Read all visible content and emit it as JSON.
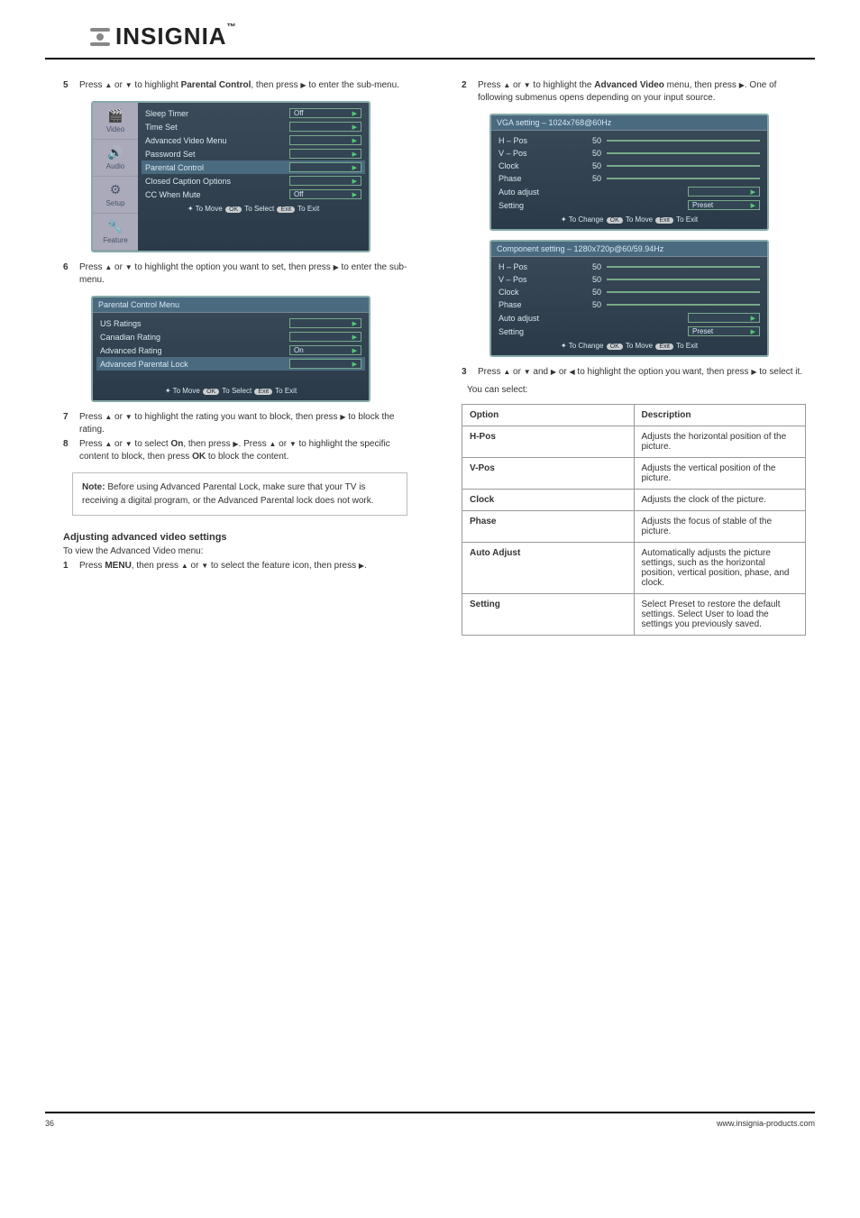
{
  "logo": {
    "text": "INSIGNIA",
    "trademark": "™"
  },
  "col1": {
    "step5": {
      "num": "5",
      "text_a": "Press ",
      "text_b": " or ",
      "text_c": " to highlight ",
      "text_bold": "Parental Control",
      "text_d": ", then press ",
      "text_e": " to enter the sub-menu."
    },
    "osd1": {
      "rows": [
        {
          "label": "Sleep Timer",
          "val": "Off",
          "hl": false
        },
        {
          "label": "Time Set",
          "val": "",
          "hl": false
        },
        {
          "label": "Advanced Video Menu",
          "val": "",
          "hl": false
        },
        {
          "label": "Password Set",
          "val": "",
          "hl": false
        },
        {
          "label": "Parental Control",
          "val": "",
          "hl": true
        },
        {
          "label": "Closed Caption Options",
          "val": "",
          "hl": false
        },
        {
          "label": "CC When Mute",
          "val": "Off",
          "hl": false
        }
      ],
      "icons": [
        {
          "glyph": "🎬",
          "label": "Video"
        },
        {
          "glyph": "🔊",
          "label": "Audio"
        },
        {
          "glyph": "⚙",
          "label": "Setup"
        },
        {
          "glyph": "🔧",
          "label": "Feature"
        }
      ],
      "controls": {
        "move": "To Move",
        "select": "To Select",
        "exit": "To Exit",
        "ok": "OK",
        "exitBtn": "Exit"
      }
    },
    "step6": {
      "num": "6",
      "text_a": "Press ",
      "text_b": " or ",
      "text_c": " to highlight the option you want to set, then press ",
      "text_d": " to enter the sub-menu."
    },
    "osd2": {
      "header": "Parental Control Menu",
      "rows": [
        {
          "label": "US Ratings",
          "val": "",
          "hl": false
        },
        {
          "label": "Canadian Rating",
          "val": "",
          "hl": false
        },
        {
          "label": "Advanced Rating",
          "val": "On",
          "hl": false
        },
        {
          "label": "Advanced Parental Lock",
          "val": "",
          "hl": true
        }
      ],
      "controls": {
        "move": "To Move",
        "select": "To Select",
        "exit": "To Exit",
        "ok": "OK",
        "exitBtn": "Exit"
      }
    },
    "step7": {
      "num": "7",
      "text_a": "Press ",
      "text_b": " or ",
      "text_c": " to highlight the rating you want to block, then press ",
      "text_d": " to block the rating."
    },
    "step8": {
      "num": "8",
      "text_a": "Press ",
      "text_b": " or ",
      "text_c": " to select ",
      "bold": "On",
      "text_d": ", then press ",
      "text_e": ". Press ",
      "text_f": " or ",
      "text_g": " to highlight the specific content to block, then press ",
      "bold2": "OK",
      "text_h": " to block the content."
    },
    "note": {
      "label": "Note:",
      "body": "Before using Advanced Parental Lock, make sure that your TV is receiving a digital program, or the Advanced Parental lock does not work."
    },
    "section_h": "Adjusting advanced video settings",
    "section_sub": "To view the Advanced Video menu:",
    "stepA1": {
      "num": "1",
      "text": "Press ",
      "bold": "MENU",
      "text2": ", then press ",
      "text3": " or ",
      "text4": " to select the feature icon, then press ",
      "text5": "."
    }
  },
  "col2": {
    "step2": {
      "num": "2",
      "text_a": "Press ",
      "text_b": " or ",
      "text_c": " to highlight the ",
      "bold": "Advanced Video",
      "text_d": " menu, then press ",
      "text_e": ". One of following submenus opens depending on your input source."
    },
    "osd3": {
      "header": "VGA setting – 1024x768@60Hz",
      "rows": [
        {
          "label": "H – Pos",
          "num": "50",
          "slider": true
        },
        {
          "label": "V – Pos",
          "num": "50",
          "slider": true
        },
        {
          "label": "Clock",
          "num": "50",
          "slider": true
        },
        {
          "label": "Phase",
          "num": "50",
          "slider": true
        },
        {
          "label": "Auto adjust",
          "num": "",
          "slider": false,
          "arrow": true
        },
        {
          "label": "Setting",
          "num": "",
          "slider": false,
          "val": "Preset",
          "arrow": true
        }
      ],
      "controls": {
        "change": "To Change",
        "move": "To Move",
        "exit": "To Exit",
        "ok": "OK",
        "exitBtn": "Exit"
      }
    },
    "osd4": {
      "header": "Component setting – 1280x720p@60/59.94Hz",
      "rows": [
        {
          "label": "H – Pos",
          "num": "50",
          "slider": true
        },
        {
          "label": "V – Pos",
          "num": "50",
          "slider": true
        },
        {
          "label": "Clock",
          "num": "50",
          "slider": true
        },
        {
          "label": "Phase",
          "num": "50",
          "slider": true
        },
        {
          "label": "Auto adjust",
          "num": "",
          "slider": false,
          "arrow": true
        },
        {
          "label": "Setting",
          "num": "",
          "slider": false,
          "val": "Preset",
          "arrow": true
        }
      ],
      "controls": {
        "change": "To Change",
        "move": "To Move",
        "exit": "To Exit",
        "ok": "OK",
        "exitBtn": "Exit"
      }
    },
    "step3": {
      "num": "3",
      "text_a": "Press ",
      "text_b": " or ",
      "text_c": " and ",
      "text_d": " or ",
      "text_e": " to highlight the option you want, then press ",
      "text_f": " to select it."
    },
    "table_intro": "You can select:",
    "table": {
      "head": {
        "opt": "Option",
        "desc": "Description"
      },
      "rows": [
        {
          "opt": "H-Pos",
          "desc": "Adjusts the horizontal position of the picture."
        },
        {
          "opt": "V-Pos",
          "desc": "Adjusts the vertical position of the picture."
        },
        {
          "opt": "Clock",
          "desc": "Adjusts the clock of the picture."
        },
        {
          "opt": "Phase",
          "desc": "Adjusts the focus of stable of the picture."
        },
        {
          "opt": "Auto Adjust",
          "desc": "Automatically adjusts the picture settings, such as the horizontal position, vertical position, phase, and clock."
        },
        {
          "opt": "Setting",
          "desc": "Select Preset to restore the default settings. Select User to load the settings you previously saved."
        }
      ]
    }
  },
  "footer": {
    "left": "36",
    "right": "www.insignia-products.com"
  }
}
